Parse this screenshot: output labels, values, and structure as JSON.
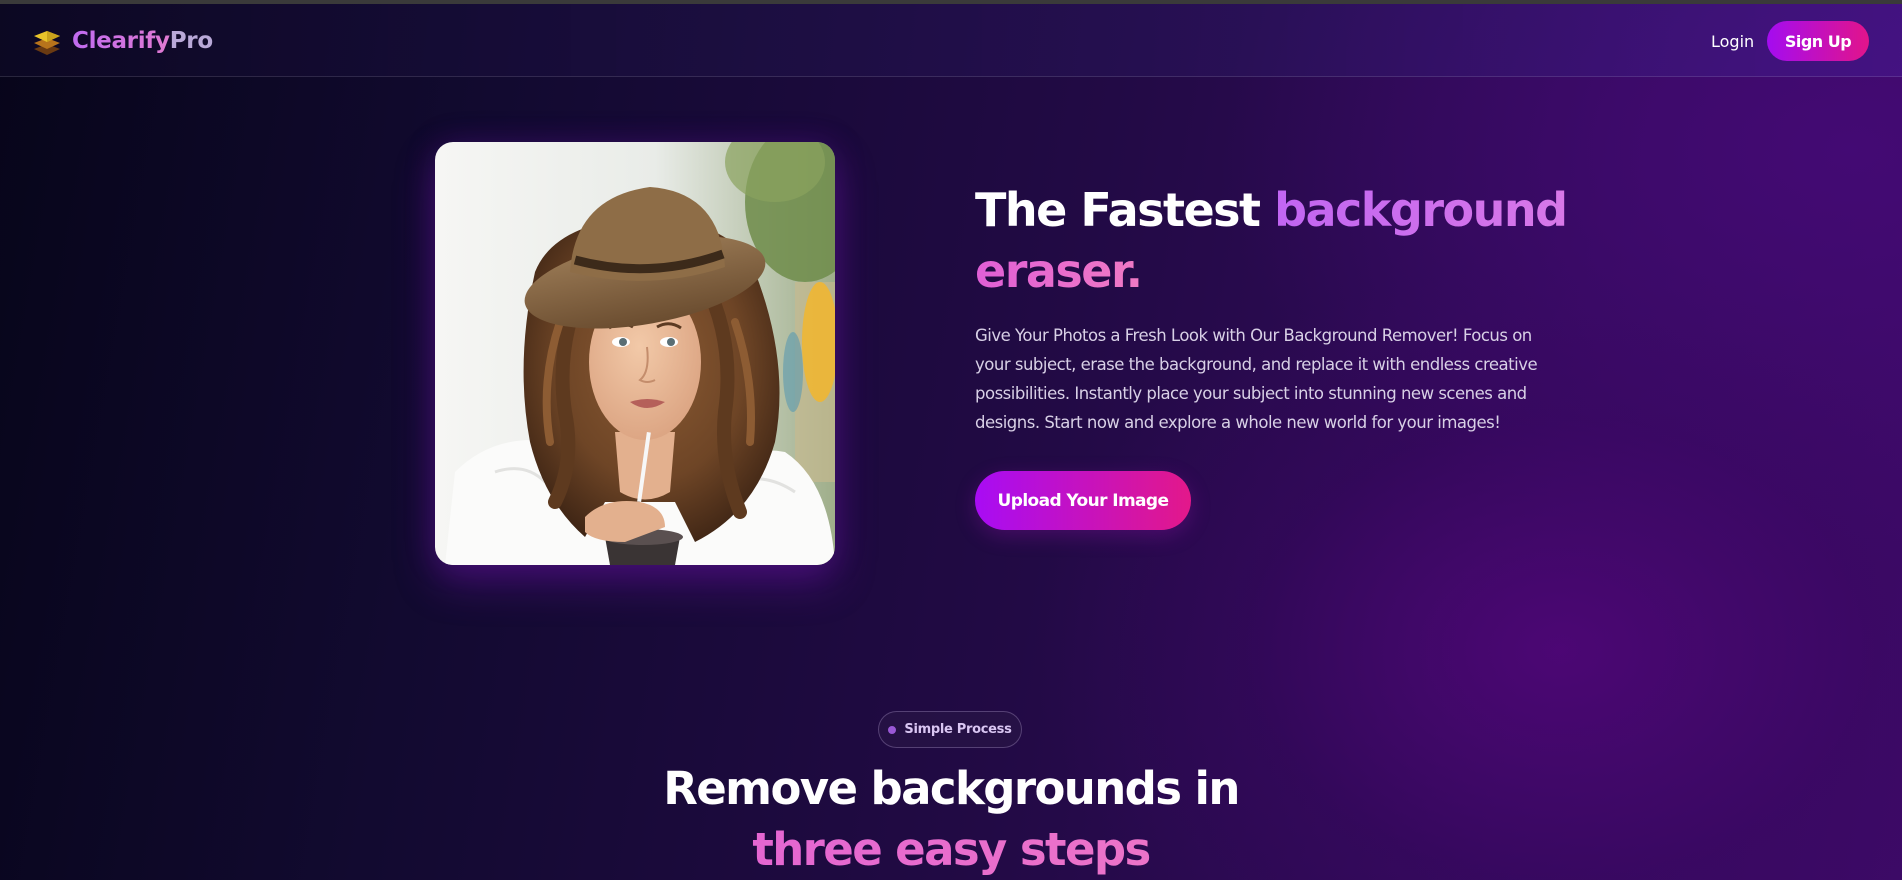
{
  "header": {
    "brand_part1": "Clearify",
    "brand_part2": "Pro",
    "login_label": "Login",
    "signup_label": "Sign Up"
  },
  "hero": {
    "title_white": "The Fastest ",
    "title_purple": "background",
    "title_pink": "eraser.",
    "description": "Give Your Photos a Fresh Look with Our Background Remover! Focus on your subject, erase the background, and replace it with endless creative possibilities. Instantly place your subject into stunning new scenes and designs. Start now and explore a whole new world for your images!",
    "upload_label": "Upload Your Image"
  },
  "process": {
    "badge_label": "Simple Process",
    "title_line1": "Remove backgrounds in",
    "title_line2": "three easy steps"
  },
  "colors": {
    "accent_purple": "#a80cf4",
    "accent_pink": "#e3188a",
    "background_dark": "#07051a"
  }
}
